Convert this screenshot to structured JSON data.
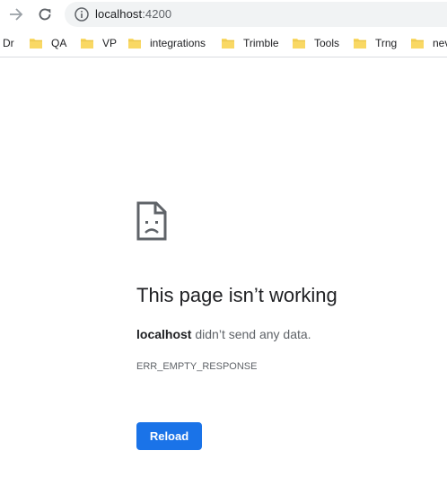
{
  "browser": {
    "url_host": "localhost",
    "url_port": ":4200",
    "icons": {
      "forward": "arrow-right-icon",
      "reload": "reload-icon",
      "site_info": "info-circle-icon"
    }
  },
  "bookmarks": [
    {
      "label": "Dr",
      "icon": "none"
    },
    {
      "label": "QA",
      "icon": "folder-icon"
    },
    {
      "label": "VP",
      "icon": "folder-icon"
    },
    {
      "label": "integrations",
      "icon": "folder-icon"
    },
    {
      "label": "Trimble",
      "icon": "folder-icon"
    },
    {
      "label": "Tools",
      "icon": "folder-icon"
    },
    {
      "label": "Trng",
      "icon": "folder-icon"
    },
    {
      "label": "nev",
      "icon": "folder-icon"
    }
  ],
  "error_page": {
    "icon": "sad-page-icon",
    "title": "This page isn’t working",
    "host": "localhost",
    "message_rest": " didn’t send any data.",
    "error_code": "ERR_EMPTY_RESPONSE",
    "reload_label": "Reload"
  },
  "colors": {
    "folder": "#f9d864",
    "folder_dark": "#e8c34a",
    "button": "#1a73e8",
    "omnibox": "#f1f3f4"
  }
}
